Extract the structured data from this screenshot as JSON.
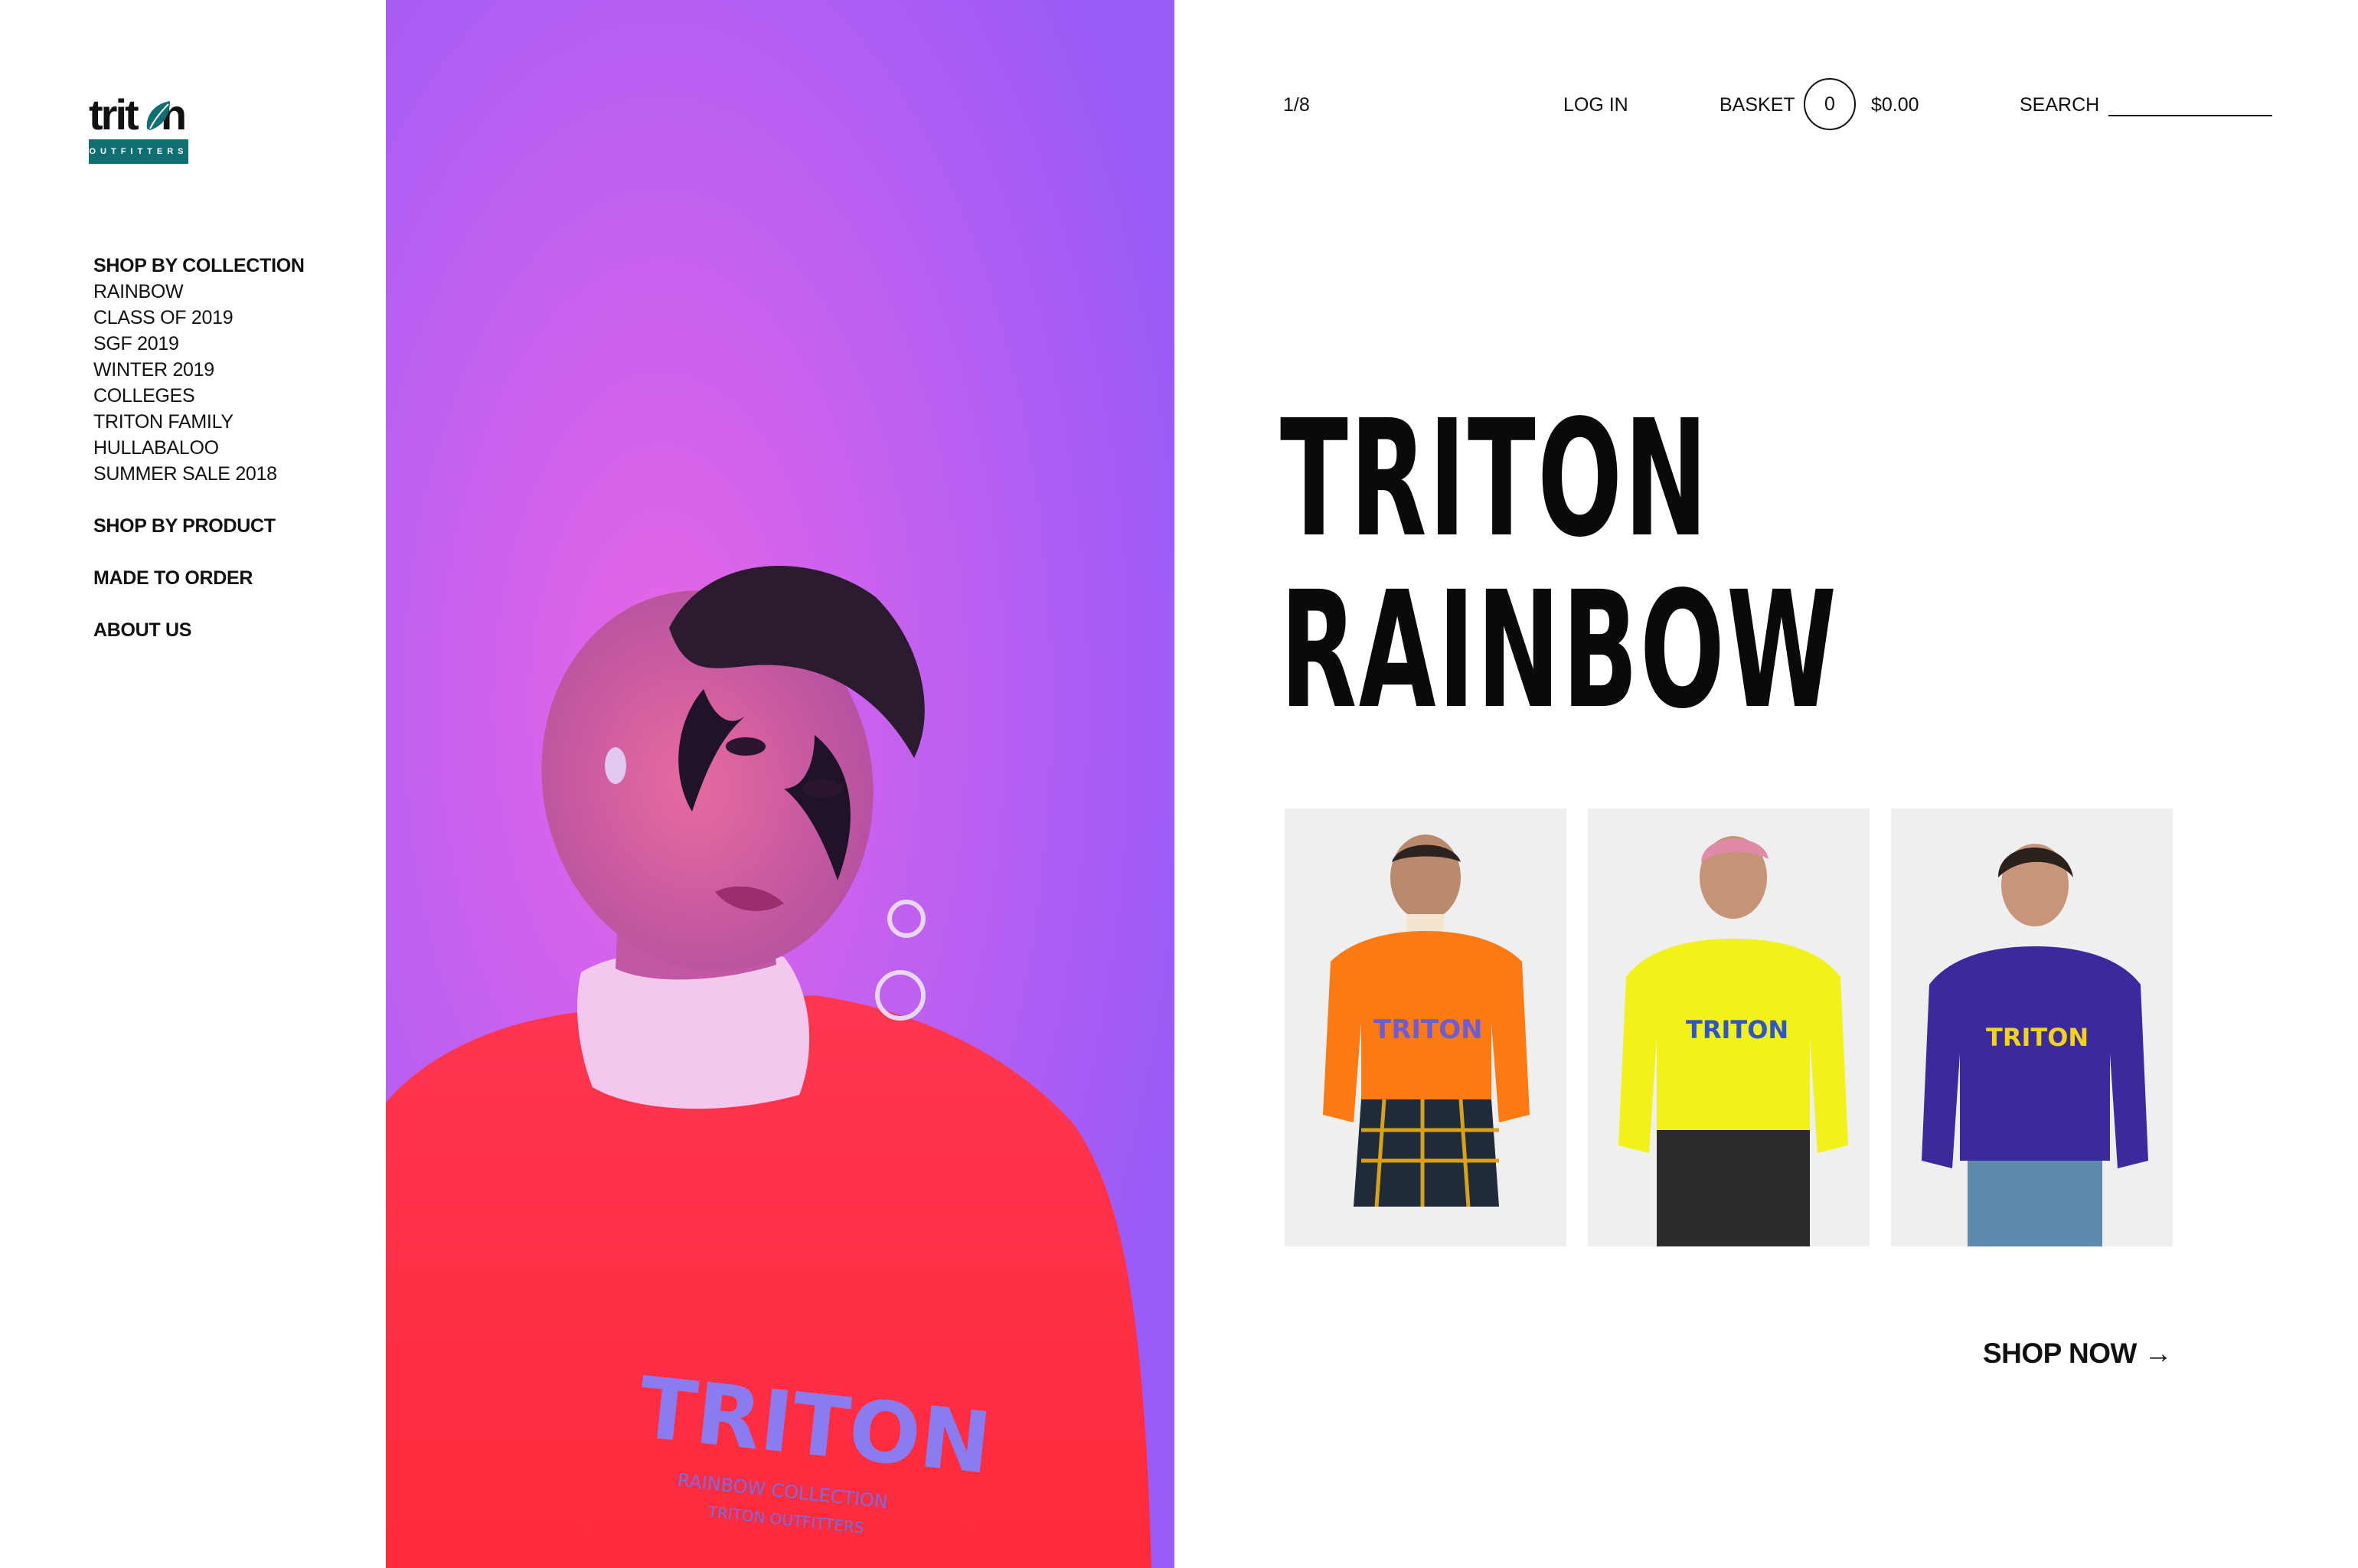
{
  "brand": {
    "wordmark": "triton",
    "tagline": "OUTFITTERS",
    "accent_color": "#0f6f72"
  },
  "sidebar": {
    "groups": [
      {
        "heading": "SHOP BY COLLECTION",
        "items": [
          "RAINBOW",
          "CLASS OF 2019",
          "SGF 2019",
          "WINTER 2019",
          "COLLEGES",
          "TRITON FAMILY",
          "HULLABALOO",
          "SUMMER SALE 2018"
        ]
      },
      {
        "heading": "SHOP BY PRODUCT",
        "items": []
      },
      {
        "heading": "MADE TO ORDER",
        "items": []
      },
      {
        "heading": "ABOUT US",
        "items": []
      }
    ]
  },
  "header": {
    "slide_counter": "1/8",
    "login_label": "LOG IN",
    "basket_label": "BASKET",
    "basket_count": "0",
    "basket_total": "$0.00",
    "search_label": "SEARCH",
    "search_value": ""
  },
  "hero": {
    "image_icon": "model-portrait",
    "sweatshirt_print": "TRITON",
    "sweatshirt_subprint_1": "RAINBOW COLLECTION",
    "sweatshirt_subprint_2": "TRITON OUTFITTERS"
  },
  "collection": {
    "title_line1": "TRITON",
    "title_line2": "RAINBOW",
    "thumbnails": [
      {
        "sweatshirt_color": "#ff7a12",
        "print_color": "#6e5bd6",
        "print": "TRITON"
      },
      {
        "sweatshirt_color": "#f1f21a",
        "print_color": "#2e56c8",
        "print": "TRITON"
      },
      {
        "sweatshirt_color": "#3a2a9e",
        "print_color": "#f1d41a",
        "print": "TRITON"
      }
    ],
    "cta_label": "SHOP NOW →"
  }
}
